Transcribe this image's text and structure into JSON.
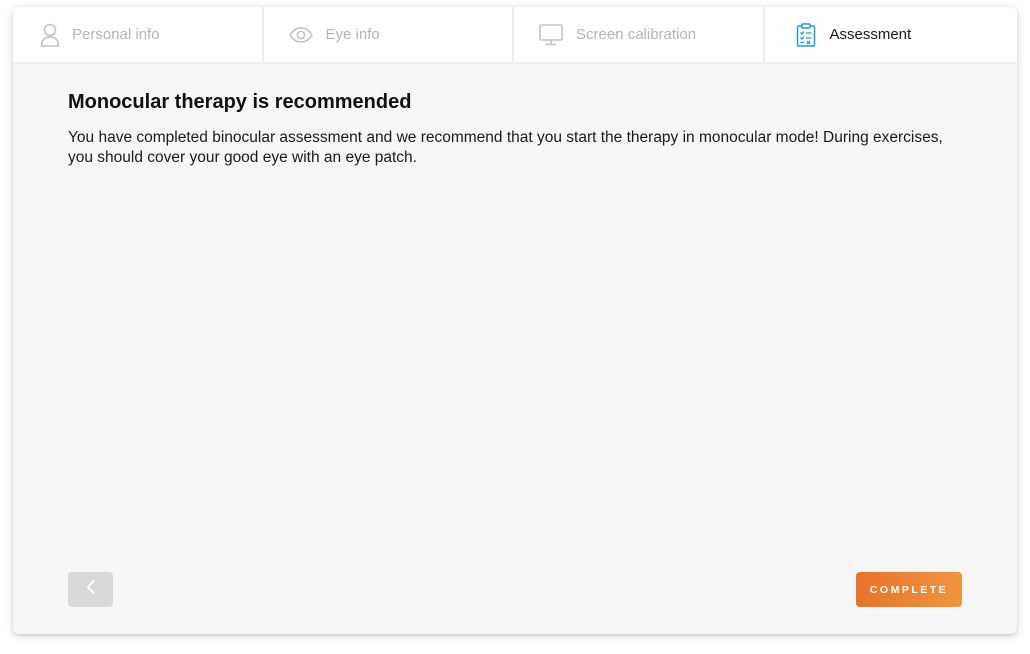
{
  "steps": [
    {
      "label": "Personal info",
      "icon": "person-icon",
      "active": false
    },
    {
      "label": "Eye info",
      "icon": "eye-icon",
      "active": false
    },
    {
      "label": "Screen calibration",
      "icon": "monitor-icon",
      "active": false
    },
    {
      "label": "Assessment",
      "icon": "clipboard-icon",
      "active": true
    }
  ],
  "main": {
    "title": "Monocular therapy is recommended",
    "description": "You have completed binocular assessment and we recommend that you start the therapy in monocular mode! During exercises, you should cover your good eye with an eye patch."
  },
  "footer": {
    "back_icon": "chevron-left-icon",
    "complete_label": "COMPLETE"
  },
  "colors": {
    "accent": "#ee8636",
    "active_icon": "#1e9bc6",
    "inactive": "#b5b5b5",
    "background": "#f5f6f5"
  }
}
